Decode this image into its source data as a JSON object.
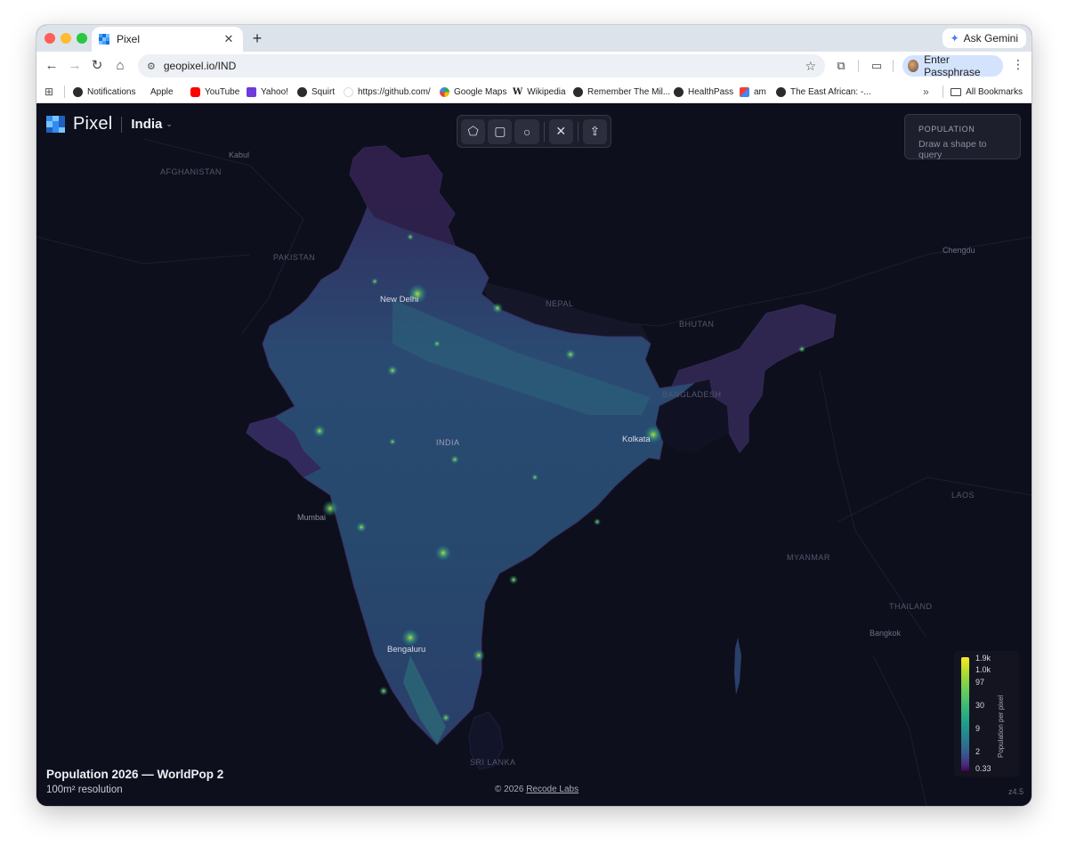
{
  "browser": {
    "tab": {
      "title": "Pixel"
    },
    "ask_gemini": "Ask Gemini",
    "url": "geopixel.io/IND",
    "profile_label": "Enter Passphrase",
    "bookmarks": [
      {
        "label": "Notifications",
        "icon": "github-icon"
      },
      {
        "label": "Apple",
        "icon": "apple-icon"
      },
      {
        "label": "YouTube",
        "icon": "youtube-icon"
      },
      {
        "label": "Yahoo!",
        "icon": "yahoo-icon"
      },
      {
        "label": "Squirt",
        "icon": "globe-icon"
      },
      {
        "label": "https://github.com/",
        "icon": "blank-page-icon"
      },
      {
        "label": "Google Maps",
        "icon": "google-maps-icon"
      },
      {
        "label": "Wikipedia",
        "icon": "wikipedia-icon"
      },
      {
        "label": "Remember The Mil...",
        "icon": "globe-icon"
      },
      {
        "label": "HealthPass",
        "icon": "globe-icon"
      },
      {
        "label": "am",
        "icon": "gmail-icon"
      },
      {
        "label": "The East African: -...",
        "icon": "globe-icon"
      }
    ],
    "all_bookmarks": "All Bookmarks"
  },
  "app": {
    "name": "Pixel",
    "country": "India",
    "panel": {
      "title": "POPULATION",
      "hint": "Draw a shape to query"
    },
    "dataset_title": "Population 2026 — WorldPop 2",
    "resolution": "100m² resolution",
    "credit_prefix": "© 2026",
    "credit_link": "Recode Labs",
    "zoom": "z4.5",
    "tools": [
      "polygon-icon",
      "rectangle-icon",
      "circle-icon",
      "close-icon",
      "share-upload-icon"
    ]
  },
  "map_labels": {
    "countries": {
      "afghanistan": "AFGHANISTAN",
      "pakistan": "PAKISTAN",
      "nepal": "NEPAL",
      "bhutan": "BHUTAN",
      "bangladesh": "BANGLADESH",
      "india": "INDIA",
      "laos": "LAOS",
      "myanmar": "MYANMAR",
      "thailand": "THAILAND",
      "sri_lanka": "SRI LANKA"
    },
    "cities": {
      "kabul": "Kabul",
      "chengdu": "Chengdu",
      "new_delhi": "New Delhi",
      "kolkata": "Kolkata",
      "mumbai": "Mumbai",
      "bengaluru": "Bengaluru",
      "bangkok": "Bangkok"
    }
  },
  "legend": {
    "title": "Population per pixel",
    "ticks": [
      "1.9k",
      "1.0k",
      "97",
      "30",
      "9",
      "2",
      "0.33"
    ],
    "colormap": [
      "#440154",
      "#3e4989",
      "#26828e",
      "#35b779",
      "#b5de2b",
      "#fde725"
    ]
  },
  "colors": {
    "map_background": "#0e0f1c",
    "land_low_density": "#3b2a5e",
    "accent_yellow": "#fde725"
  }
}
